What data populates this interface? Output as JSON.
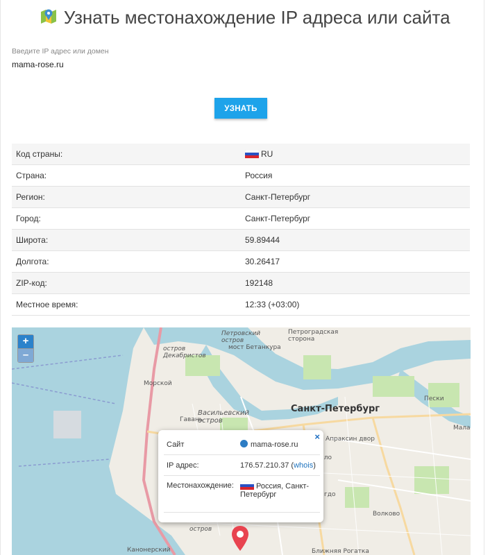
{
  "page": {
    "title": "Узнать местонахождение IP адреса или сайта",
    "input_label": "Введите IP адрес или домен",
    "input_value": "mama-rose.ru",
    "button_label": "УЗНАТЬ"
  },
  "info_table": [
    {
      "key": "Код страны:",
      "value": "RU",
      "flag": "ru"
    },
    {
      "key": "Страна:",
      "value": "Россия"
    },
    {
      "key": "Регион:",
      "value": "Санкт-Петербург"
    },
    {
      "key": "Город:",
      "value": "Санкт-Петербург"
    },
    {
      "key": "Широта:",
      "value": "59.89444"
    },
    {
      "key": "Долгота:",
      "value": "30.26417"
    },
    {
      "key": "ZIP-код:",
      "value": "192148"
    },
    {
      "key": "Местное время:",
      "value": "12:33 (+03:00)"
    }
  ],
  "map": {
    "zoom_in": "+",
    "zoom_out": "–",
    "labels": {
      "island_dekabristov": "остров Декабристов",
      "petrovsky": "Петровский остров",
      "betankura": "мост Бетанкура",
      "petrogradskaya": "Петроградская сторона",
      "morskoy": "Морской",
      "vasilevsky": "Васильевский остров",
      "gavan": "Гавань",
      "spb": "Санкт-Петербург",
      "peski": "Пески",
      "apraksin": "Апраксин двор",
      "volkovo": "Волково",
      "ostrov": "остров",
      "kanonersky": "Канонерский",
      "ploshchad": "Пло",
      "mala": "Мала",
      "gdo": "гдо",
      "blizhnyaya": "Ближняя Рогатка"
    },
    "popup": {
      "close": "×",
      "site_key": "Сайт",
      "site_value": "mama-rose.ru",
      "ip_key": "IP адрес:",
      "ip_value": "176.57.210.37",
      "whois_open": "(",
      "whois_link": "whois",
      "whois_close": ")",
      "location_key": "Местонахождение:",
      "location_value": "Россия, Санкт-Петербург"
    }
  },
  "colors": {
    "accent": "#1ea3ea",
    "water": "#aad3df",
    "land": "#f0ede6",
    "pin": "#e8434f"
  }
}
